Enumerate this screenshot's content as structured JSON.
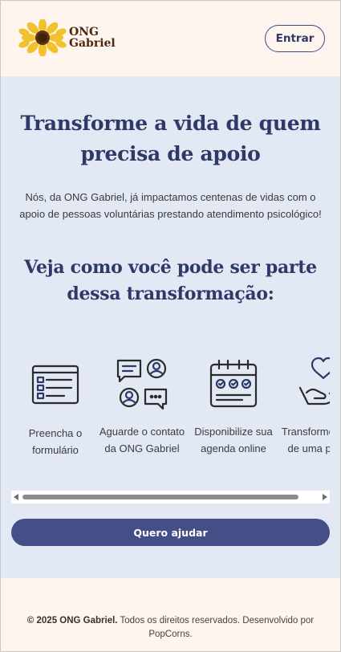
{
  "header": {
    "logo_line1": "ONG",
    "logo_line2": "Gabriel",
    "login_label": "Entrar"
  },
  "hero": {
    "title": "Transforme a vida de quem precisa de apoio",
    "description": "Nós, da ONG Gabriel, já impactamos centenas de vidas com o apoio de pessoas voluntárias prestando atendimento psicológico!"
  },
  "steps_section": {
    "title": "Veja como você pode ser parte dessa transformação:",
    "steps": [
      {
        "icon": "form-icon",
        "label": "Preencha o formulário"
      },
      {
        "icon": "contact-chat-icon",
        "label": "Aguarde o contato da ONG Gabriel"
      },
      {
        "icon": "calendar-icon",
        "label": "Disponibilize sua agenda online"
      },
      {
        "icon": "heart-hand-icon",
        "label": "Transforme a vida de uma pessoa"
      }
    ]
  },
  "cta": {
    "label": "Quero ajudar"
  },
  "footer": {
    "brand": "© 2025 ONG Gabriel.",
    "text": " Todos os direitos reservados. Desenvolvido por PopCorns."
  },
  "colors": {
    "primary": "#434f86",
    "title": "#2f3968",
    "background": "#fdf5ee",
    "main_background": "#e2e9f5",
    "logo_brown": "#4a2810",
    "sunflower": "#f2c12e"
  }
}
